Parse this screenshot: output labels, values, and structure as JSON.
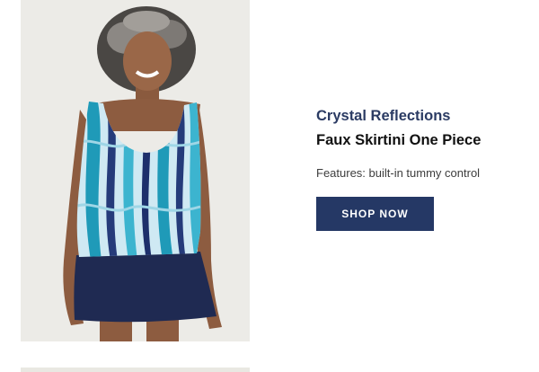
{
  "product": {
    "brand": "Crystal Reflections",
    "name": "Faux Skirtini One Piece",
    "features": "Features: built-in tummy control",
    "cta_label": "SHOP NOW"
  },
  "colors": {
    "brand_navy": "#2b3b63",
    "button_bg": "#253865",
    "photo_bg": "#ecebe7"
  }
}
